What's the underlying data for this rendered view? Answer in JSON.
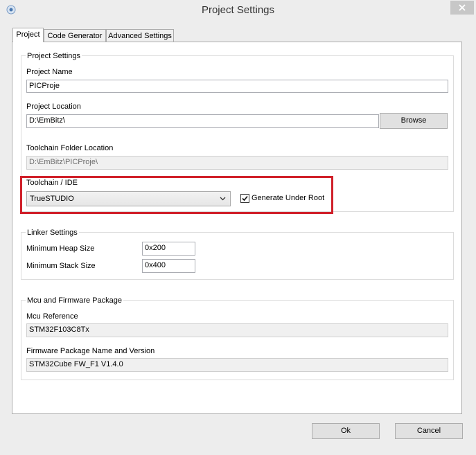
{
  "window": {
    "title": "Project Settings",
    "icon": "app-icon",
    "close_icon": "close-icon"
  },
  "tabs": [
    {
      "label": "Project",
      "active": true
    },
    {
      "label": "Code Generator",
      "active": false
    },
    {
      "label": "Advanced Settings",
      "active": false
    }
  ],
  "project_settings": {
    "group_title": "Project Settings",
    "project_name_label": "Project Name",
    "project_name_value": "PICProje",
    "project_location_label": "Project Location",
    "project_location_value": "D:\\EmBitz\\",
    "browse_label": "Browse",
    "toolchain_folder_label": "Toolchain Folder Location",
    "toolchain_folder_value": "D:\\EmBitz\\PICProje\\",
    "toolchain_ide_label": "Toolchain / IDE",
    "toolchain_ide_value": "TrueSTUDIO",
    "generate_under_root_label": "Generate Under Root",
    "generate_under_root_checked": true
  },
  "linker_settings": {
    "group_title": "Linker Settings",
    "min_heap_label": "Minimum Heap Size",
    "min_heap_value": "0x200",
    "min_stack_label": "Minimum Stack Size",
    "min_stack_value": "0x400"
  },
  "mcu_firmware": {
    "group_title": "Mcu and Firmware Package",
    "mcu_reference_label": "Mcu Reference",
    "mcu_reference_value": "STM32F103C8Tx",
    "firmware_package_label": "Firmware Package Name and Version",
    "firmware_package_value": "STM32Cube FW_F1 V1.4.0"
  },
  "footer": {
    "ok_label": "Ok",
    "cancel_label": "Cancel"
  },
  "colors": {
    "highlight": "#d0202a",
    "window_bg": "#ededed"
  }
}
